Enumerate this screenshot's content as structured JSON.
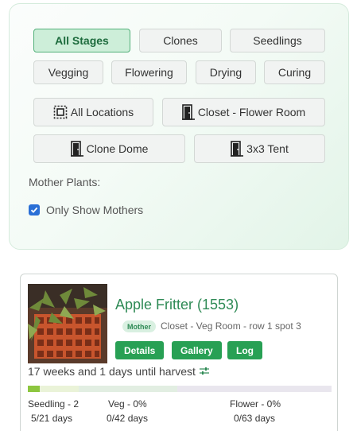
{
  "filters": {
    "stages": {
      "all": "All Stages",
      "clones": "Clones",
      "seedlings": "Seedlings",
      "vegging": "Vegging",
      "flowering": "Flowering",
      "drying": "Drying",
      "curing": "Curing"
    },
    "locations": {
      "all": "All Locations",
      "closet": "Closet - Flower Room",
      "clone_dome": "Clone Dome",
      "tent": "3x3 Tent"
    },
    "mother_plants_label": "Mother Plants:",
    "only_mothers_label": "Only Show Mothers",
    "only_mothers_checked": true
  },
  "plant": {
    "name": "Apple Fritter (1553)",
    "badge": "Mother",
    "location": "Closet - Veg Room - row 1 spot 3",
    "actions": {
      "details": "Details",
      "gallery": "Gallery",
      "log": "Log"
    },
    "harvest_text": "17 weeks and 1 days until harvest",
    "progress_fraction": 0.04,
    "stages": [
      {
        "label": "Seedling - 2",
        "days": "5/21 days"
      },
      {
        "label": "Veg - 0%",
        "days": "0/42 days"
      },
      {
        "label": "Flower - 0%",
        "days": "0/63 days"
      }
    ]
  },
  "colors": {
    "accent": "#28a054",
    "active_filter_bg": "#cdeed9",
    "checkbox": "#2a6fd6",
    "progress_seedling": "#8dc63f"
  },
  "icons": {
    "location_all": "dotted-square-icon",
    "location_room": "door-icon",
    "harvest": "sliders-icon",
    "checkbox": "checkmark-icon"
  }
}
